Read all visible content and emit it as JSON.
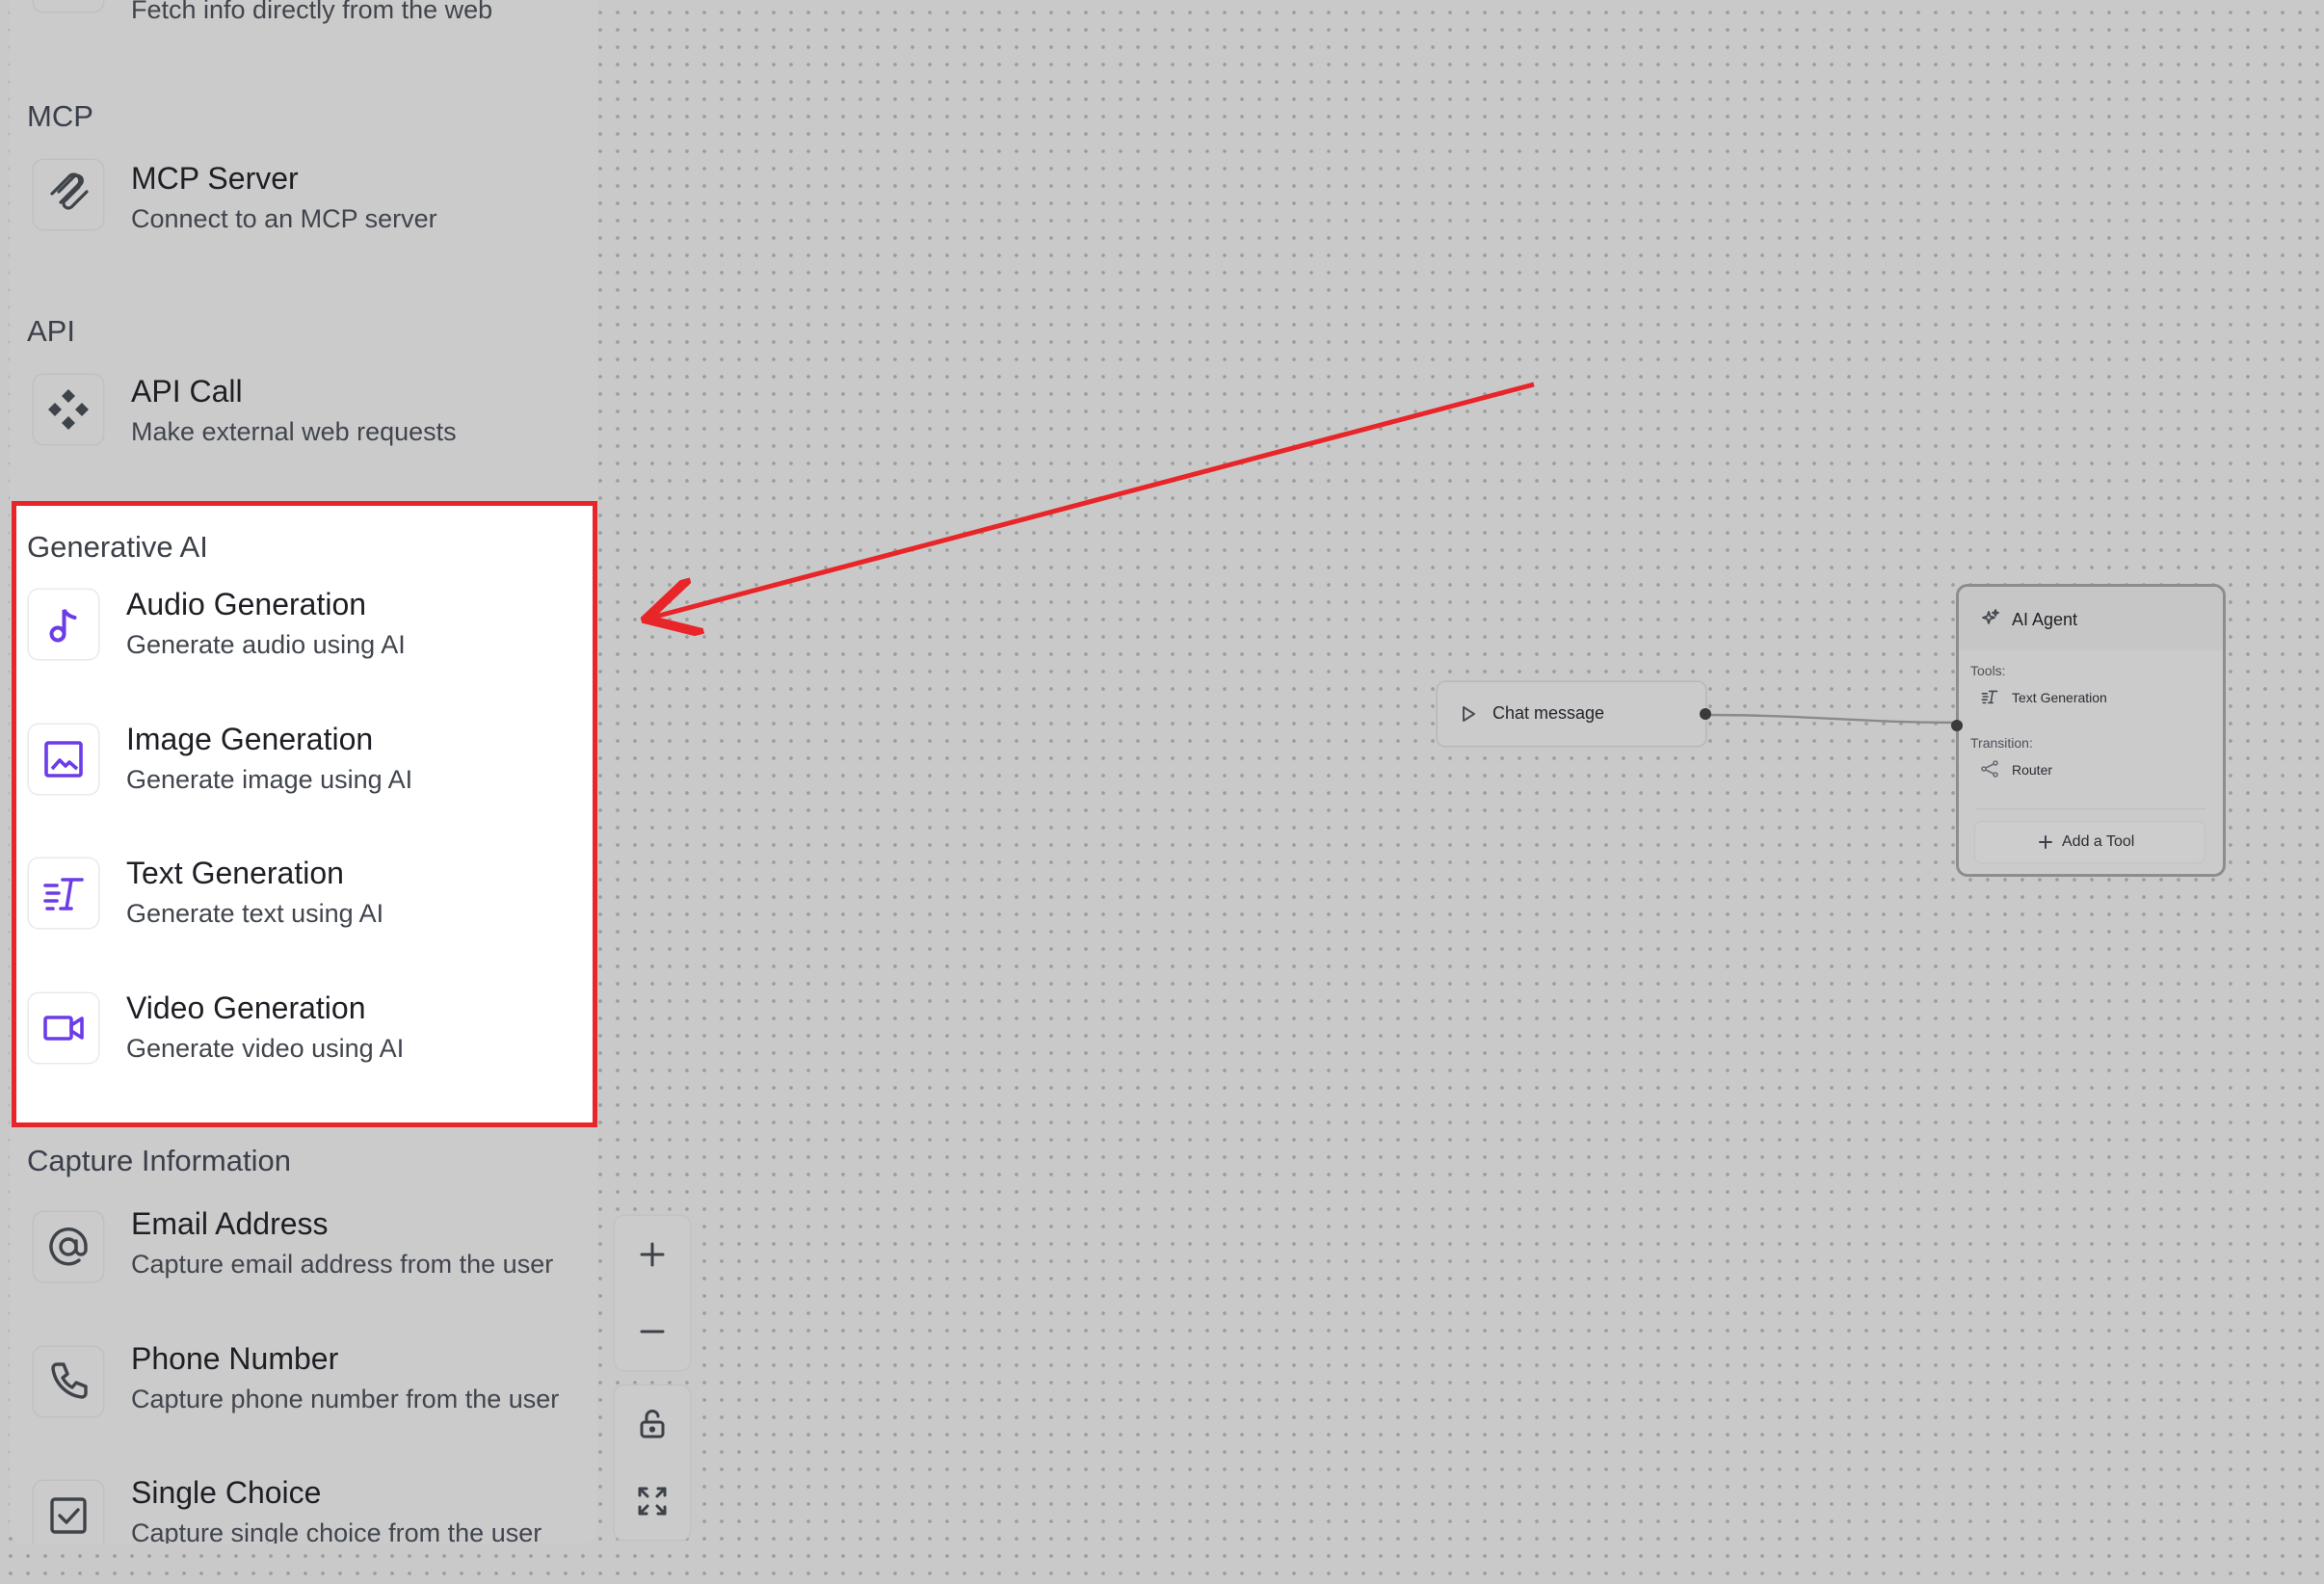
{
  "sidebar": {
    "web_item_subtitle": "Fetch info directly from the web",
    "sections": {
      "mcp": {
        "title": "MCP",
        "items": [
          {
            "title": "MCP Server",
            "subtitle": "Connect to an MCP server",
            "icon": "mcp-icon"
          }
        ]
      },
      "api": {
        "title": "API",
        "items": [
          {
            "title": "API Call",
            "subtitle": "Make external web requests",
            "icon": "api-icon"
          }
        ]
      },
      "generative_ai": {
        "title": "Generative AI",
        "items": [
          {
            "title": "Audio Generation",
            "subtitle": "Generate audio using AI",
            "icon": "music-note-icon"
          },
          {
            "title": "Image Generation",
            "subtitle": "Generate image using AI",
            "icon": "image-icon"
          },
          {
            "title": "Text Generation",
            "subtitle": "Generate text using AI",
            "icon": "text-generation-icon"
          },
          {
            "title": "Video Generation",
            "subtitle": "Generate video using AI",
            "icon": "video-camera-icon"
          }
        ]
      },
      "capture": {
        "title": "Capture Information",
        "items": [
          {
            "title": "Email Address",
            "subtitle": "Capture email address from the user",
            "icon": "at-sign-icon"
          },
          {
            "title": "Phone Number",
            "subtitle": "Capture phone number from the user",
            "icon": "phone-icon"
          },
          {
            "title": "Single Choice",
            "subtitle": "Capture single choice from the user",
            "icon": "checkbox-icon"
          }
        ]
      }
    }
  },
  "canvas": {
    "chat_node": {
      "label": "Chat message",
      "icon": "play-icon"
    },
    "agent_node": {
      "title": "AI Agent",
      "tools_label": "Tools:",
      "tools": [
        {
          "label": "Text Generation",
          "icon": "text-generation-icon"
        }
      ],
      "transition_label": "Transition:",
      "transitions": [
        {
          "label": "Router",
          "icon": "router-icon"
        }
      ],
      "add_tool_label": "Add a Tool"
    }
  },
  "controls": {
    "zoom_in": "plus-icon",
    "zoom_out": "minus-icon",
    "lock": "unlock-icon",
    "fit_view": "fit-view-icon"
  },
  "colors": {
    "highlight_border": "#e8262a",
    "annotation_arrow": "#e8262a",
    "generative_icon": "#6c3ce8",
    "canvas_background": "#c9c9c9"
  }
}
